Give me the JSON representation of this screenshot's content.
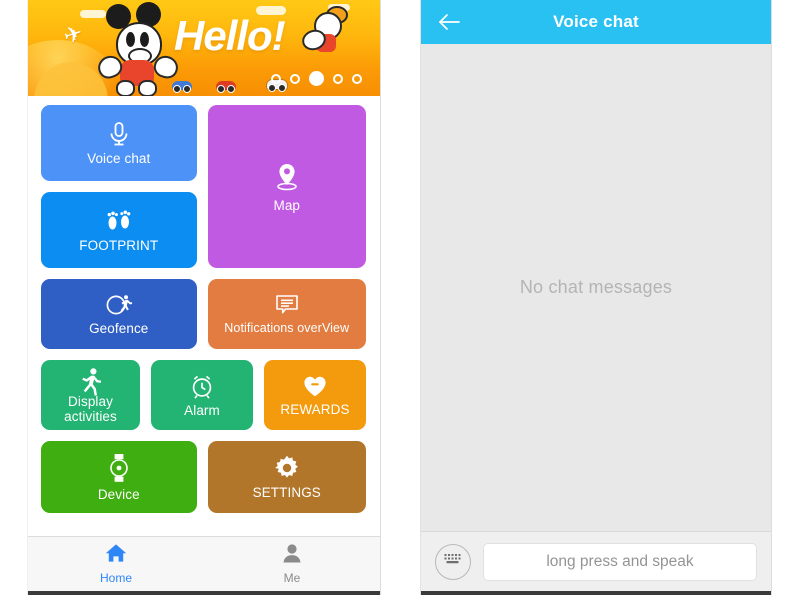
{
  "left_screen": {
    "banner": {
      "greeting": "Hello!",
      "mascot_icon": "cartoon-mouse-mascot",
      "plane_icon": "airplane-icon",
      "dots_total": 5,
      "dots_active_index": 2,
      "bg_color_start": "#ffc915",
      "bg_color_end": "#f78f03"
    },
    "tiles": [
      {
        "id": "voice-chat",
        "label": "Voice chat",
        "icon": "microphone-icon",
        "color": "#4d92f7"
      },
      {
        "id": "footprint",
        "label": "FOOTPRINT",
        "icon": "footprints-icon",
        "color": "#0b8df2"
      },
      {
        "id": "map",
        "label": "Map",
        "icon": "map-pin-icon",
        "color": "#c15ae2"
      },
      {
        "id": "geofence",
        "label": "Geofence",
        "icon": "geofence-circle-icon",
        "color": "#2f5fc4"
      },
      {
        "id": "notifications",
        "label": "Notifications overView",
        "icon": "message-bubble-icon",
        "color": "#e27c40"
      },
      {
        "id": "display-activities",
        "label_line1": "Display",
        "label_line2": "activities",
        "icon": "running-person-icon",
        "color": "#23b473"
      },
      {
        "id": "alarm",
        "label": "Alarm",
        "icon": "alarm-clock-icon",
        "color": "#23b473"
      },
      {
        "id": "rewards",
        "label": "REWARDS",
        "icon": "heart-icon",
        "color": "#f39a0d"
      },
      {
        "id": "device",
        "label": "Device",
        "icon": "smartwatch-icon",
        "color": "#3fae10"
      },
      {
        "id": "settings",
        "label": "SETTINGS",
        "icon": "gear-icon",
        "color": "#b2762a"
      }
    ],
    "tabbar": {
      "tabs": [
        {
          "label": "Home",
          "icon": "home-icon",
          "active": true,
          "color": "#2f86f6"
        },
        {
          "label": "Me",
          "icon": "person-icon",
          "active": false,
          "color": "#8b8b8b"
        }
      ]
    }
  },
  "right_screen": {
    "navbar": {
      "title": "Voice chat",
      "back_icon": "back-arrow-icon",
      "bg_color": "#29c0f2"
    },
    "chat": {
      "empty_message": "No chat messages",
      "bg_color": "#e8e8e8"
    },
    "input_bar": {
      "keyboard_icon": "keyboard-icon",
      "speak_button_label": "long press and speak"
    }
  }
}
